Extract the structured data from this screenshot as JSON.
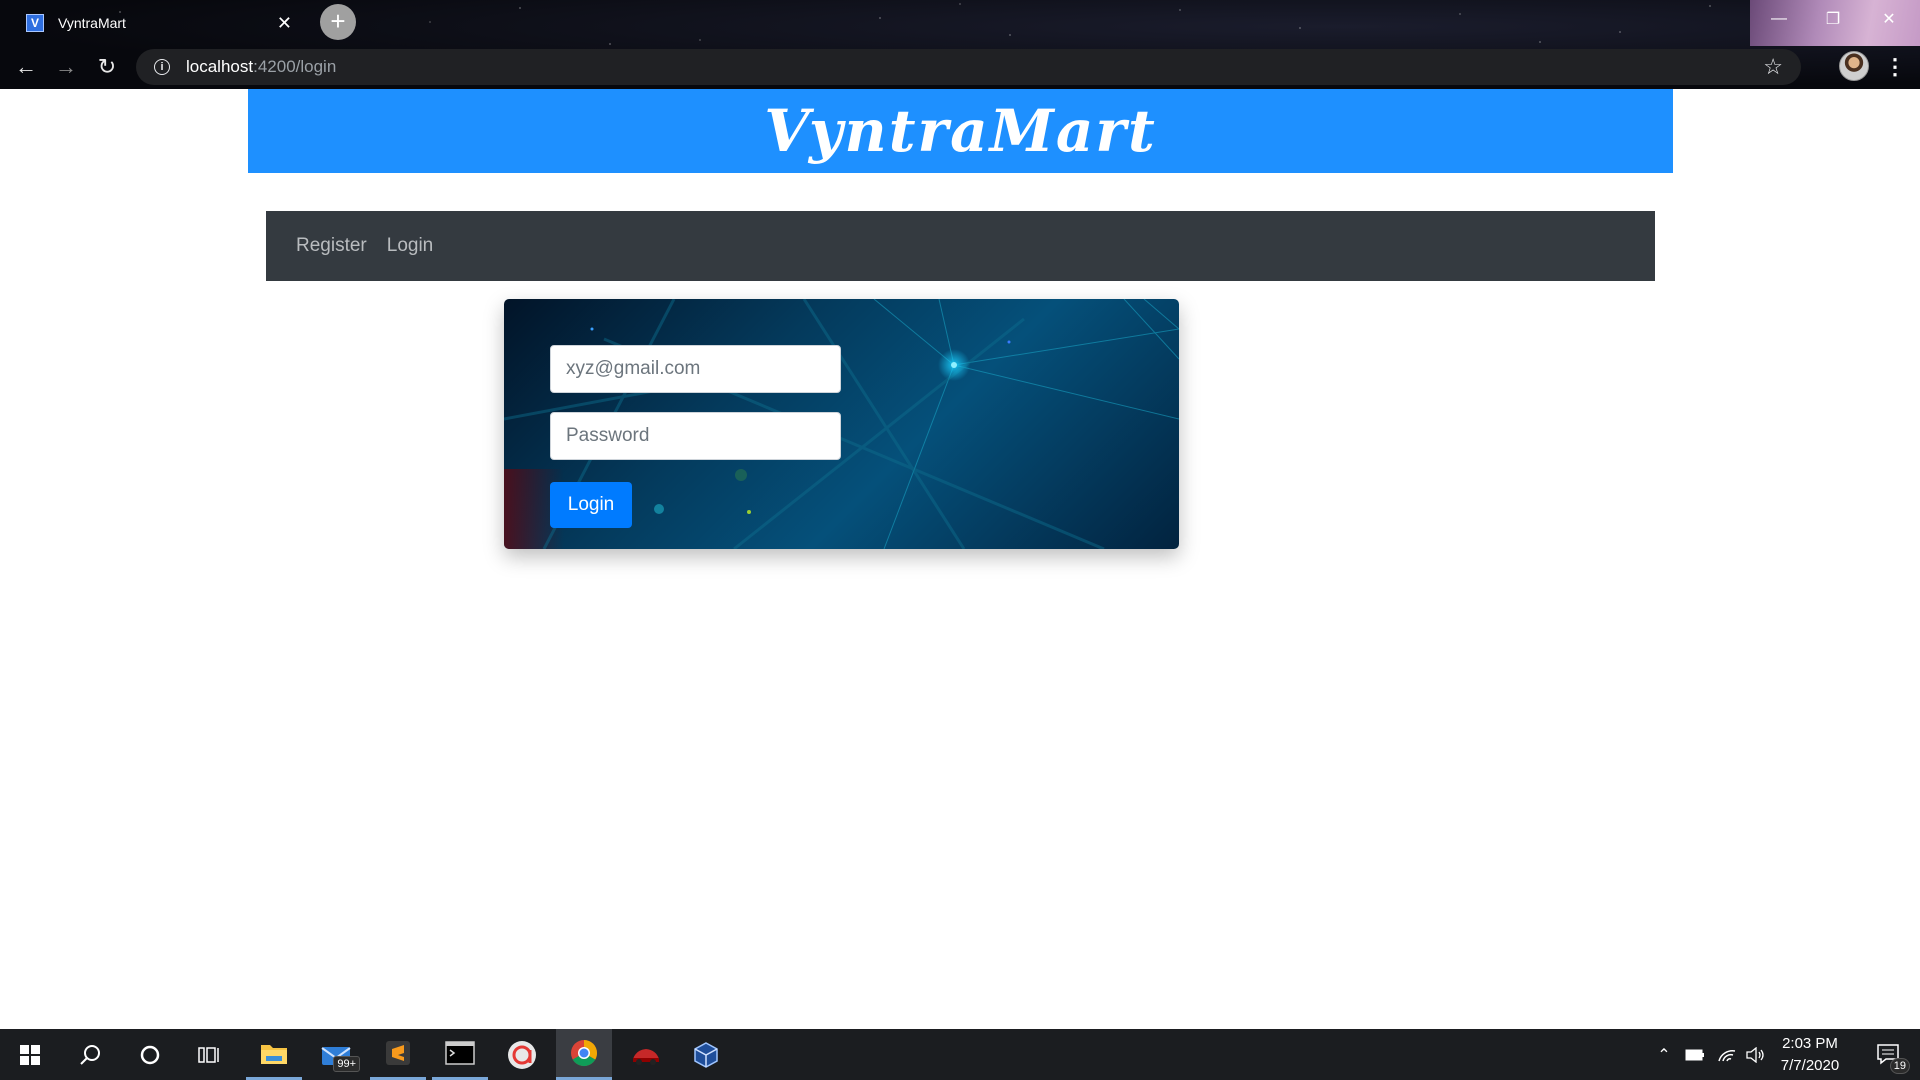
{
  "browser": {
    "tab_title": "VyntraMart",
    "favicon_letter": "V",
    "url_host": "localhost",
    "url_path": ":4200/login"
  },
  "page": {
    "brand": "VyntraMart",
    "nav": {
      "register": "Register",
      "login": "Login"
    },
    "login_form": {
      "email_placeholder": "xyz@gmail.com",
      "password_placeholder": "Password",
      "submit_label": "Login"
    }
  },
  "taskbar": {
    "mail_badge": "99+",
    "time": "2:03 PM",
    "date": "7/7/2020",
    "notification_count": "19"
  },
  "colors": {
    "banner": "#1e90ff",
    "navbar": "#343a40",
    "primary_button": "#007bff"
  }
}
